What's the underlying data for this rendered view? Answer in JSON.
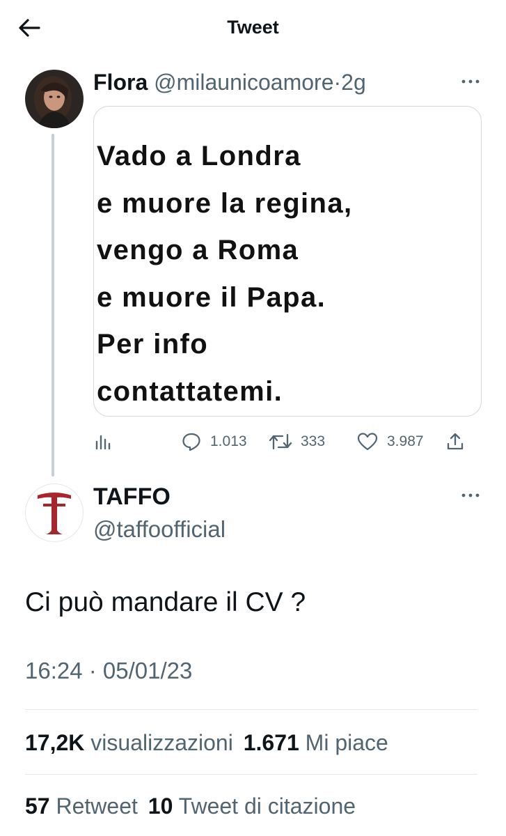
{
  "header": {
    "title": "Tweet"
  },
  "original_tweet": {
    "name": "Flora",
    "handle": "@milaunicoamore",
    "separator": "·",
    "age": "2g",
    "media_lines": [
      "Vado a Londra",
      "e muore la regina,",
      "vengo a Roma",
      "e muore il Papa.",
      "Per info",
      "contattatemi."
    ],
    "actions": {
      "replies": "1.013",
      "retweets": "333",
      "likes": "3.987"
    }
  },
  "reply": {
    "name": "TAFFO",
    "handle": "@taffoofficial",
    "text": "Ci può mandare il CV ?",
    "timestamp": "16:24 · 05/01/23"
  },
  "stats": {
    "views_count": "17,2K",
    "views_label": "visualizzazioni",
    "likes_count": "1.671",
    "likes_label": "Mi piace",
    "retweets_count": "57",
    "retweets_label": "Retweet",
    "quotes_count": "10",
    "quotes_label": "Tweet di citazione"
  },
  "colors": {
    "text": "#0f1419",
    "secondary": "#536471",
    "divider": "#e1e8ed",
    "taffo_red": "#a8252b"
  }
}
